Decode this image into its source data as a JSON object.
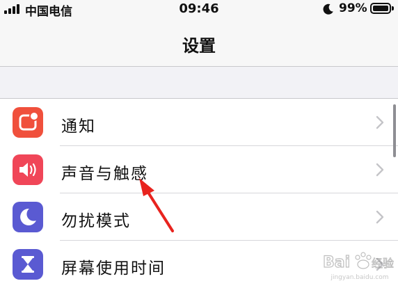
{
  "status_bar": {
    "carrier": "中国电信",
    "time": "09:46",
    "battery_percent": "99%",
    "battery_level": 0.99,
    "signal_bars": 4,
    "moon_icon": "do-not-disturb-moon-icon"
  },
  "nav": {
    "title": "设置"
  },
  "settings_items": [
    {
      "label": "通知",
      "icon": "notifications-icon",
      "color": "#f0503c"
    },
    {
      "label": "声音与触感",
      "icon": "speaker-icon",
      "color": "#f04658"
    },
    {
      "label": "勿扰模式",
      "icon": "moon-icon",
      "color": "#5a5ad2"
    },
    {
      "label": "屏幕使用时间",
      "icon": "hourglass-icon",
      "color": "#5a5ad2"
    }
  ],
  "colors": {
    "annotation_arrow": "#e8231e",
    "background": "#f2f2f6"
  },
  "watermark": {
    "logo": "Baidu 经验",
    "url": "jingyan.baidu.com"
  }
}
